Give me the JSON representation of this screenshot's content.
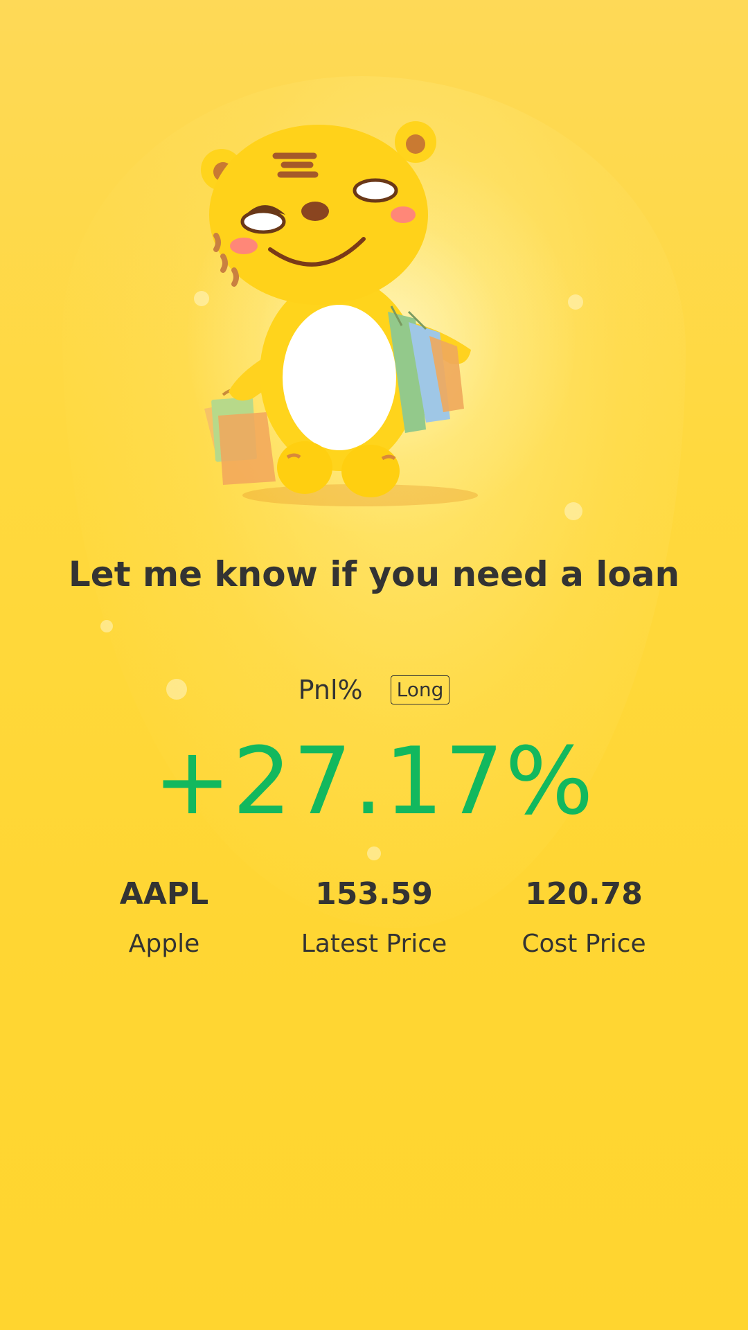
{
  "tagline": "Let me know if you need a loan",
  "pnl": {
    "label": "Pnl%",
    "badge": "Long",
    "value": "+27.17%"
  },
  "stats": [
    {
      "value": "AAPL",
      "label": "Apple"
    },
    {
      "value": "153.59",
      "label": "Latest Price"
    },
    {
      "value": "120.78",
      "label": "Cost Price"
    }
  ],
  "colors": {
    "background": "#ffd93e",
    "positive": "#12b85e",
    "text": "#333333"
  },
  "icons": {
    "mascot": "tiger-mascot-illustration"
  }
}
